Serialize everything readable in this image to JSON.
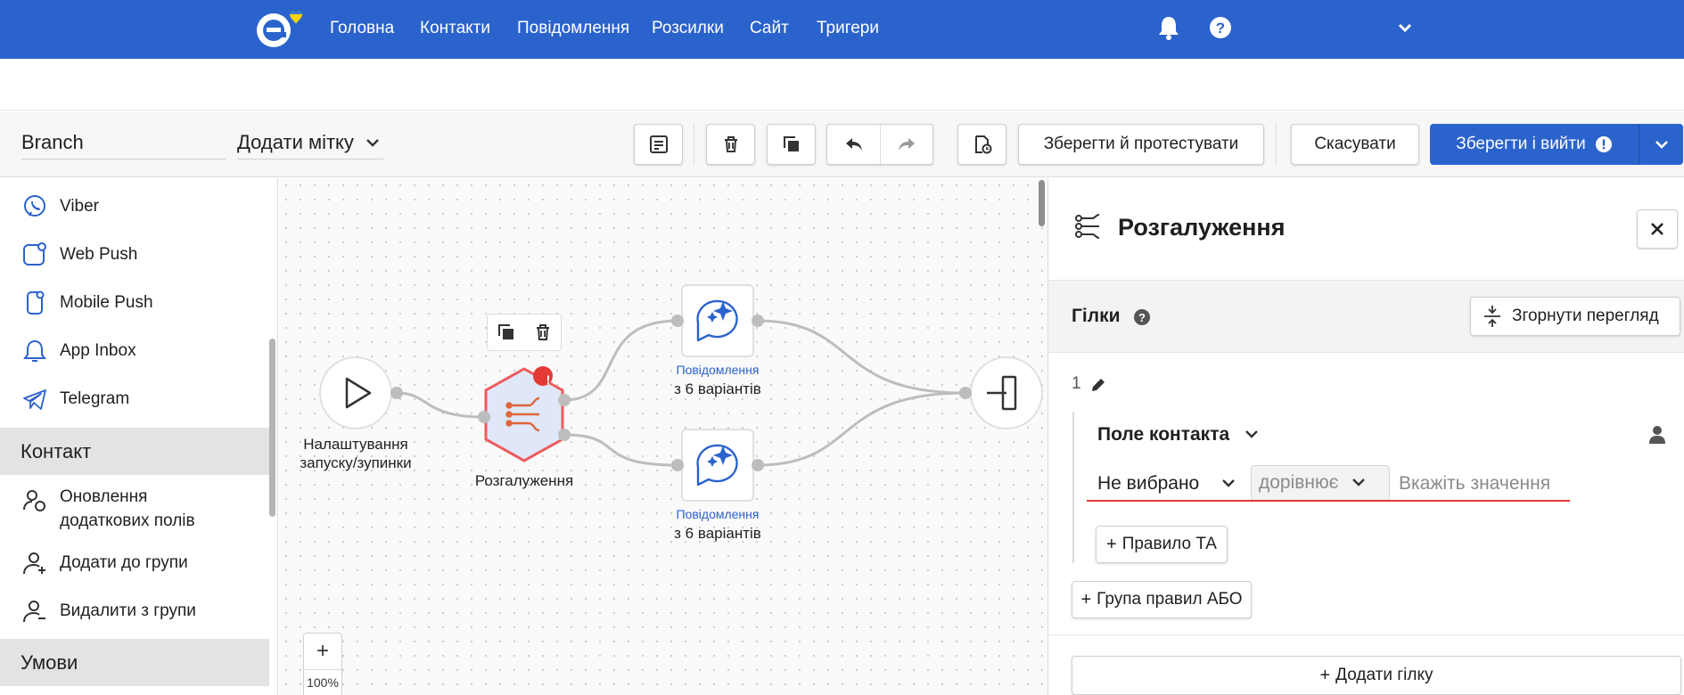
{
  "nav": {
    "items": [
      "Головна",
      "Контакти",
      "Повідомлення",
      "Розсилки",
      "Сайт",
      "Тригери"
    ],
    "icons": [
      "bell-icon",
      "help-icon",
      "chevron-down-icon"
    ]
  },
  "toolbar": {
    "workflow_name": "Branch",
    "add_tag": "Додати мітку",
    "save_test": "Зберегти й протестувати",
    "cancel": "Скасувати",
    "save_exit": "Зберегти і вийти"
  },
  "sidebar": {
    "channels": [
      {
        "label": "Viber",
        "icon": "viber-icon"
      },
      {
        "label": "Web Push",
        "icon": "web-push-icon"
      },
      {
        "label": "Mobile Push",
        "icon": "mobile-push-icon"
      },
      {
        "label": "App Inbox",
        "icon": "app-inbox-icon"
      },
      {
        "label": "Telegram",
        "icon": "telegram-icon"
      }
    ],
    "section_contact": "Контакт",
    "contact_items": [
      {
        "label": "Оновлення\nдодаткових полів",
        "line1": "Оновлення",
        "line2": "додаткових полів",
        "icon": "user-edit-icon"
      },
      {
        "label": "Додати до групи",
        "icon": "user-add-icon"
      },
      {
        "label": "Видалити з групи",
        "icon": "user-remove-icon"
      }
    ],
    "section_conditions": "Умови"
  },
  "canvas": {
    "start_label_line1": "Налаштування",
    "start_label_line2": "запуску/зупинки",
    "branch_label": "Розгалуження",
    "message_sub": "Повідомлення",
    "message_label": "з 6 варіантів",
    "zoom_plus": "+",
    "zoom_level": "100%",
    "warning_mark": "!"
  },
  "panel": {
    "title": "Розгалуження",
    "branches_label": "Гілки",
    "collapse": "Згорнути перегляд",
    "branch_number": "1",
    "field_title": "Поле контакта",
    "field_value": "Не вибрано",
    "operator": "дорівнює",
    "value_placeholder": "Вкажіть значення",
    "and_rule": "Правило ТА",
    "or_group": "Група правил АБО",
    "add_branch": "Додати гілку"
  },
  "colors": {
    "brand": "#2b63cc",
    "error": "#e53935",
    "branch_accent": "#e0663a",
    "node_fill": "#dfe7f8"
  }
}
